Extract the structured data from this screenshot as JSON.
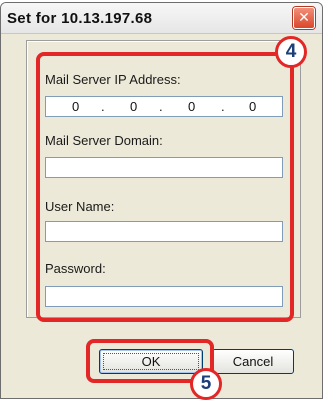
{
  "window": {
    "title": "Set for 10.13.197.68",
    "close_glyph": "✕"
  },
  "form": {
    "mail_server_ip_label": "Mail Server IP Address:",
    "ip_octets": [
      "0",
      "0",
      "0",
      "0"
    ],
    "ip_separator": ".",
    "mail_server_domain_label": "Mail Server Domain:",
    "mail_server_domain_value": "",
    "user_name_label": "User Name:",
    "user_name_value": "",
    "password_label": "Password:",
    "password_value": ""
  },
  "buttons": {
    "ok_label": "OK",
    "cancel_label": "Cancel"
  },
  "annotations": {
    "callout_4": "4",
    "callout_5": "5",
    "highlight_color": "#e32626"
  }
}
